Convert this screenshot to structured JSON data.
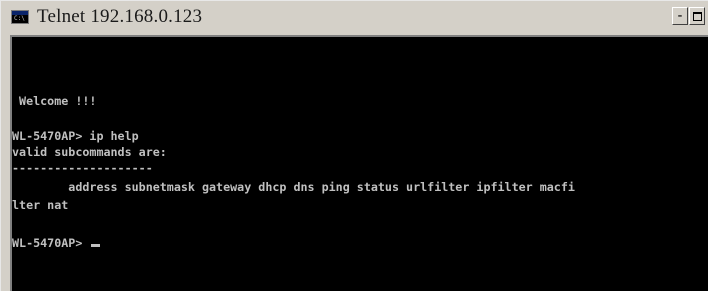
{
  "window": {
    "title": "Telnet 192.168.0.123",
    "icon_label": "C:\\"
  },
  "controls": {
    "minimize_label": "-"
  },
  "console": {
    "lines": [
      " Welcome !!!",
      "WL-5470AP> ip help",
      "valid subcommands are:",
      "--------------------",
      "        address subnetmask gateway dhcp dns ping status urlfilter ipfilter macfi",
      "lter nat",
      "WL-5470AP> "
    ],
    "text_color": "#c0c0c0",
    "background": "#000000"
  }
}
